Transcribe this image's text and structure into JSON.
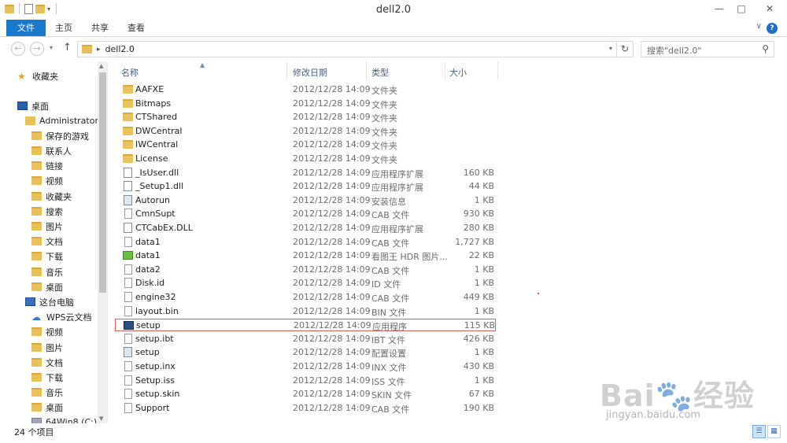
{
  "window": {
    "title": "dell2.0"
  },
  "ribbon": {
    "tabs": [
      "文件",
      "主页",
      "共享",
      "查看"
    ]
  },
  "address": {
    "path": "dell2.0",
    "search_placeholder": "搜索\"dell2.0\""
  },
  "nav": {
    "items": [
      {
        "label": "收藏夹",
        "icon": "star-icon"
      },
      {
        "label": "桌面",
        "icon": "desktop-icon"
      },
      {
        "label": "Administrator",
        "icon": "user-folder-icon"
      },
      {
        "label": "保存的游戏",
        "icon": "folder-icon"
      },
      {
        "label": "联系人",
        "icon": "folder-icon"
      },
      {
        "label": "链接",
        "icon": "folder-icon"
      },
      {
        "label": "视频",
        "icon": "folder-icon"
      },
      {
        "label": "收藏夹",
        "icon": "folder-icon"
      },
      {
        "label": "搜索",
        "icon": "folder-icon"
      },
      {
        "label": "图片",
        "icon": "folder-icon"
      },
      {
        "label": "文档",
        "icon": "folder-icon"
      },
      {
        "label": "下载",
        "icon": "folder-icon"
      },
      {
        "label": "音乐",
        "icon": "folder-icon"
      },
      {
        "label": "桌面",
        "icon": "folder-icon"
      },
      {
        "label": "这台电脑",
        "icon": "computer-icon"
      },
      {
        "label": "WPS云文档",
        "icon": "cloud-icon"
      },
      {
        "label": "视频",
        "icon": "folder-icon"
      },
      {
        "label": "图片",
        "icon": "folder-icon"
      },
      {
        "label": "文档",
        "icon": "folder-icon"
      },
      {
        "label": "下载",
        "icon": "folder-icon"
      },
      {
        "label": "音乐",
        "icon": "folder-icon"
      },
      {
        "label": "桌面",
        "icon": "folder-icon"
      },
      {
        "label": "64Win8 (C:)",
        "icon": "drive-icon"
      }
    ]
  },
  "columns": {
    "name": "名称",
    "date": "修改日期",
    "type": "类型",
    "size": "大小"
  },
  "files": [
    {
      "name": "AAFXE",
      "date": "2012/12/28 14:09",
      "type": "文件夹",
      "size": "",
      "icon": "folder"
    },
    {
      "name": "Bitmaps",
      "date": "2012/12/28 14:09",
      "type": "文件夹",
      "size": "",
      "icon": "folder"
    },
    {
      "name": "CTShared",
      "date": "2012/12/28 14:09",
      "type": "文件夹",
      "size": "",
      "icon": "folder"
    },
    {
      "name": "DWCentral",
      "date": "2012/12/28 14:09",
      "type": "文件夹",
      "size": "",
      "icon": "folder"
    },
    {
      "name": "IWCentral",
      "date": "2012/12/28 14:09",
      "type": "文件夹",
      "size": "",
      "icon": "folder"
    },
    {
      "name": "License",
      "date": "2012/12/28 14:09",
      "type": "文件夹",
      "size": "",
      "icon": "folder"
    },
    {
      "name": "_IsUser.dll",
      "date": "2012/12/28 14:09",
      "type": "应用程序扩展",
      "size": "160 KB",
      "icon": "dll"
    },
    {
      "name": "_Setup1.dll",
      "date": "2012/12/28 14:09",
      "type": "应用程序扩展",
      "size": "44 KB",
      "icon": "dll"
    },
    {
      "name": "Autorun",
      "date": "2012/12/28 14:09",
      "type": "安装信息",
      "size": "1 KB",
      "icon": "cfg"
    },
    {
      "name": "CmnSupt",
      "date": "2012/12/28 14:09",
      "type": "CAB 文件",
      "size": "930 KB",
      "icon": "file"
    },
    {
      "name": "CTCabEx.DLL",
      "date": "2012/12/28 14:09",
      "type": "应用程序扩展",
      "size": "280 KB",
      "icon": "dll"
    },
    {
      "name": "data1",
      "date": "2012/12/28 14:09",
      "type": "CAB 文件",
      "size": "1,727 KB",
      "icon": "file"
    },
    {
      "name": "data1",
      "date": "2012/12/28 14:09",
      "type": "看图王 HDR 图片...",
      "size": "22 KB",
      "icon": "hdr"
    },
    {
      "name": "data2",
      "date": "2012/12/28 14:09",
      "type": "CAB 文件",
      "size": "1 KB",
      "icon": "file"
    },
    {
      "name": "Disk.id",
      "date": "2012/12/28 14:09",
      "type": "ID 文件",
      "size": "1 KB",
      "icon": "file"
    },
    {
      "name": "engine32",
      "date": "2012/12/28 14:09",
      "type": "CAB 文件",
      "size": "449 KB",
      "icon": "file"
    },
    {
      "name": "layout.bin",
      "date": "2012/12/28 14:09",
      "type": "BIN 文件",
      "size": "1 KB",
      "icon": "file"
    },
    {
      "name": "setup",
      "date": "2012/12/28 14:09",
      "type": "应用程序",
      "size": "115 KB",
      "icon": "exe",
      "selected": true
    },
    {
      "name": "setup.ibt",
      "date": "2012/12/28 14:09",
      "type": "IBT 文件",
      "size": "426 KB",
      "icon": "file"
    },
    {
      "name": "setup",
      "date": "2012/12/28 14:09",
      "type": "配置设置",
      "size": "1 KB",
      "icon": "cfg"
    },
    {
      "name": "setup.inx",
      "date": "2012/12/28 14:09",
      "type": "INX 文件",
      "size": "430 KB",
      "icon": "file"
    },
    {
      "name": "Setup.iss",
      "date": "2012/12/28 14:09",
      "type": "ISS 文件",
      "size": "1 KB",
      "icon": "file"
    },
    {
      "name": "setup.skin",
      "date": "2012/12/28 14:09",
      "type": "SKIN 文件",
      "size": "67 KB",
      "icon": "file"
    },
    {
      "name": "Support",
      "date": "2012/12/28 14:09",
      "type": "CAB 文件",
      "size": "190 KB",
      "icon": "file"
    }
  ],
  "status": {
    "item_count": "24 个项目"
  },
  "watermark": {
    "logo": "Bai🐾经验",
    "url": "jingyan.baidu.com"
  }
}
